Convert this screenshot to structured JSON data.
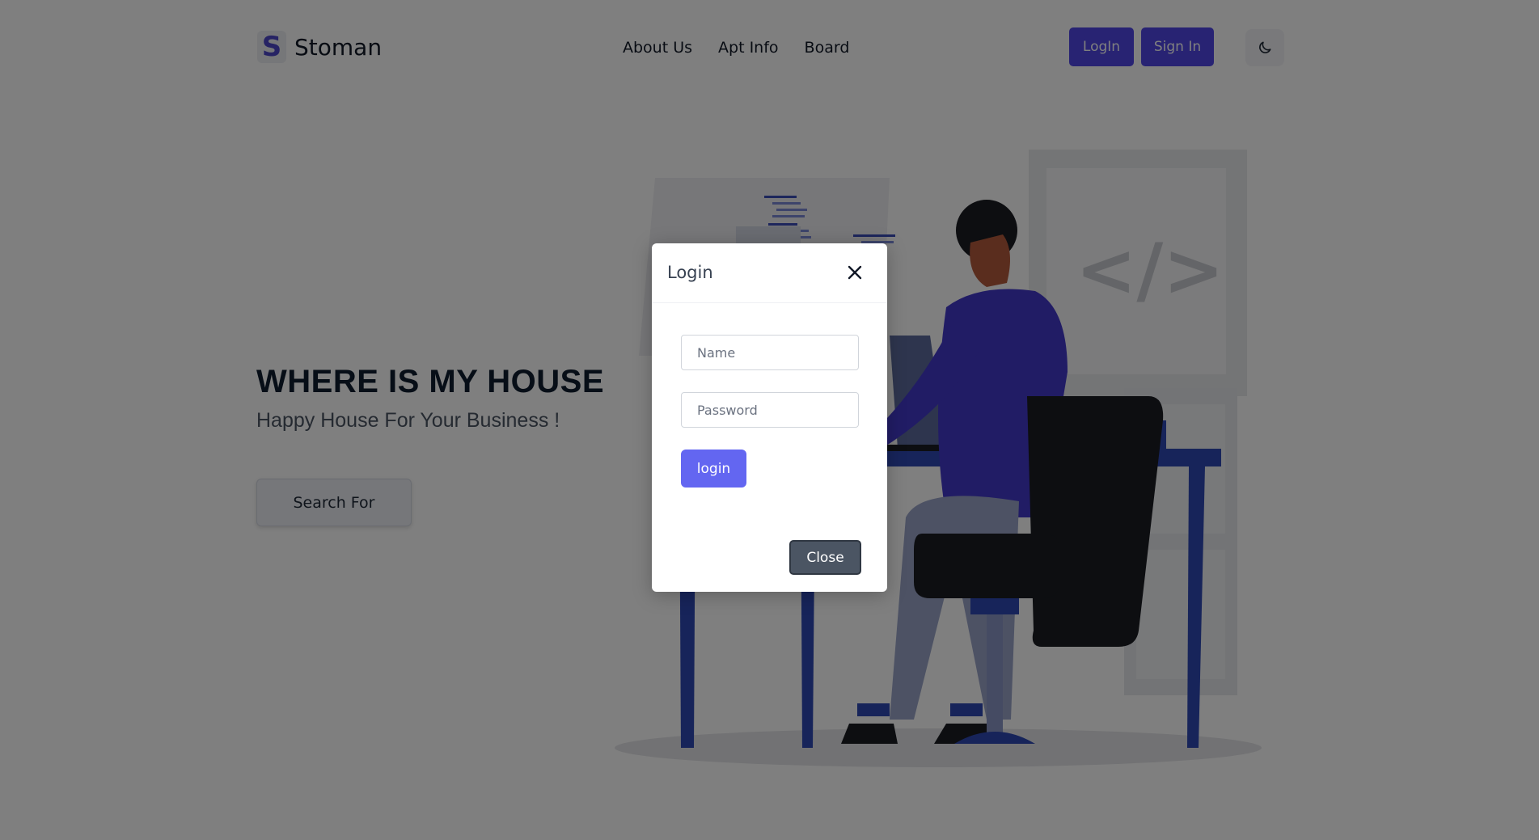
{
  "header": {
    "brand_letter": "S",
    "brand_name": "Stoman",
    "nav": [
      "About Us",
      "Apt Info",
      "Board"
    ],
    "login_label": "LogIn",
    "signin_label": "Sign In",
    "theme_icon": "moon-icon"
  },
  "hero": {
    "title": "WHERE IS MY HOUSE",
    "subtitle": "Happy House For Your Business !",
    "search_label": "Search For"
  },
  "modal": {
    "title": "Login",
    "name_placeholder": "Name",
    "password_placeholder": "Password",
    "login_label": "login",
    "close_label": "Close",
    "close_icon": "close-icon"
  },
  "colors": {
    "accent": "#5147e6",
    "modal_button": "#6366f1",
    "close_button": "#4b5563",
    "overlay": "rgba(0,0,0,0.5)"
  }
}
